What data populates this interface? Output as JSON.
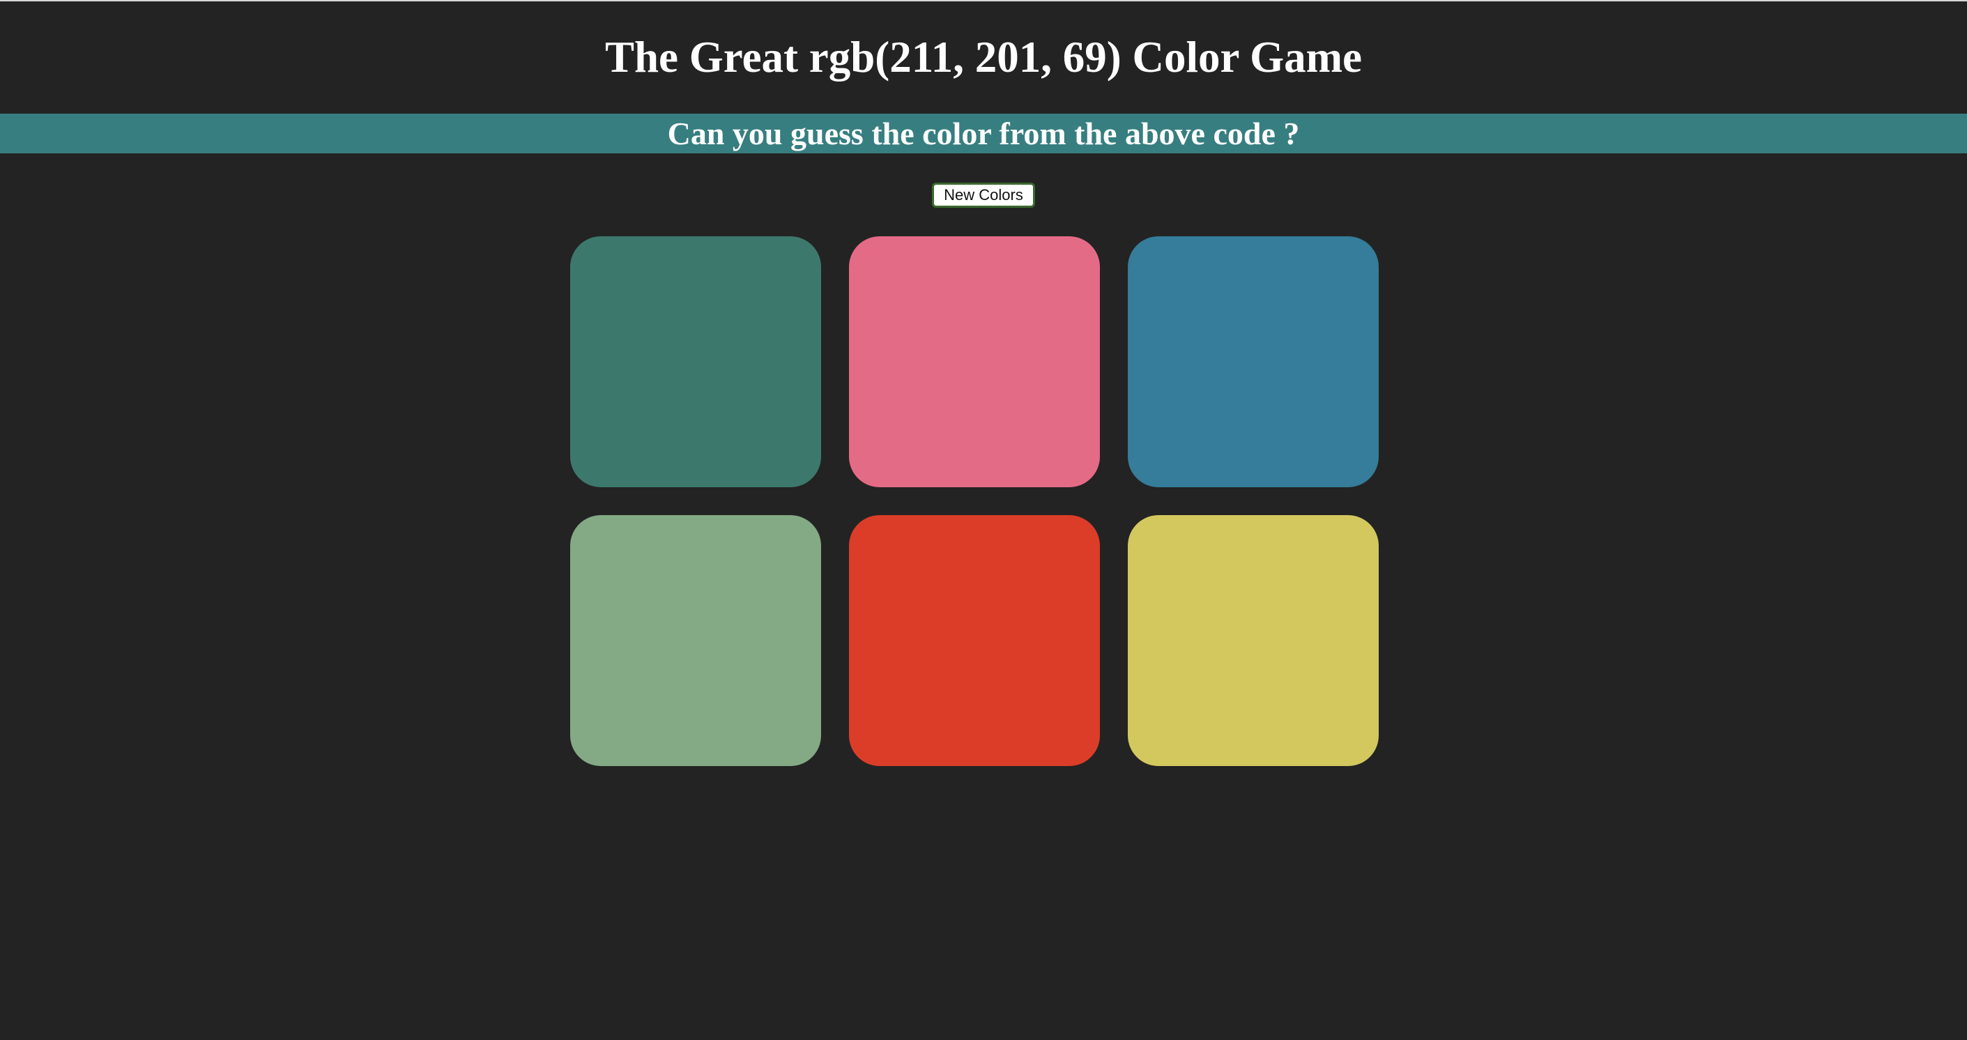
{
  "header": {
    "title": "The Great rgb(211, 201, 69) Color Game",
    "subtitle": "Can you guess the color from the above code ?"
  },
  "controls": {
    "new_colors_label": "New Colors"
  },
  "squares": [
    {
      "color": "#3d786d"
    },
    {
      "color": "#e46b86"
    },
    {
      "color": "#357d9a"
    },
    {
      "color": "#83aa84"
    },
    {
      "color": "#dc3d28"
    },
    {
      "color": "#d3c85e"
    }
  ],
  "colors": {
    "background": "#232323",
    "banner": "#377e80",
    "text": "#ffffff"
  }
}
